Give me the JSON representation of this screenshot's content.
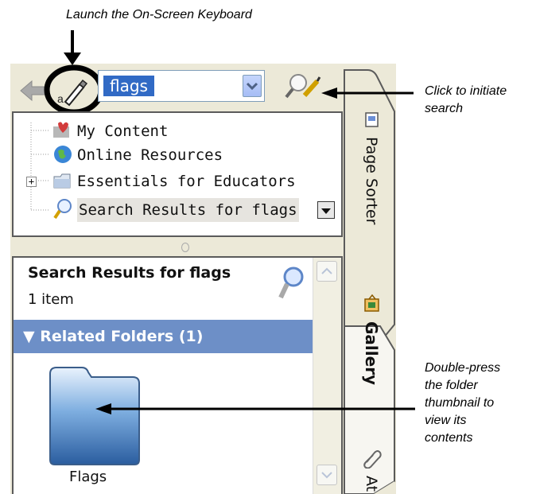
{
  "annotations": {
    "keyboard": "Launch the On-Screen Keyboard",
    "search": [
      "Click to initiate",
      "search"
    ],
    "folder": [
      "Double-press",
      "the folder",
      "thumbnail to",
      "view its",
      "contents"
    ]
  },
  "toolbar": {
    "back_icon": "back-arrow-icon",
    "keyboard_icon": "on-screen-keyboard-icon",
    "search_value": "flags",
    "search_icon": "magnifier-icon"
  },
  "tree": {
    "items": [
      {
        "label": "My Content",
        "icon": "my-content-icon"
      },
      {
        "label": "Online Resources",
        "icon": "globe-icon"
      },
      {
        "label": "Essentials for Educators",
        "icon": "folder-icon",
        "expander": "+"
      },
      {
        "label": "Search Results for flags",
        "icon": "magnifier-icon"
      }
    ]
  },
  "results": {
    "title": "Search Results for flags",
    "count": "1 item",
    "section": "Related Folders (1)",
    "folder_label": "Flags"
  },
  "tabs": [
    "Page Sorter",
    "Gallery",
    "At"
  ]
}
